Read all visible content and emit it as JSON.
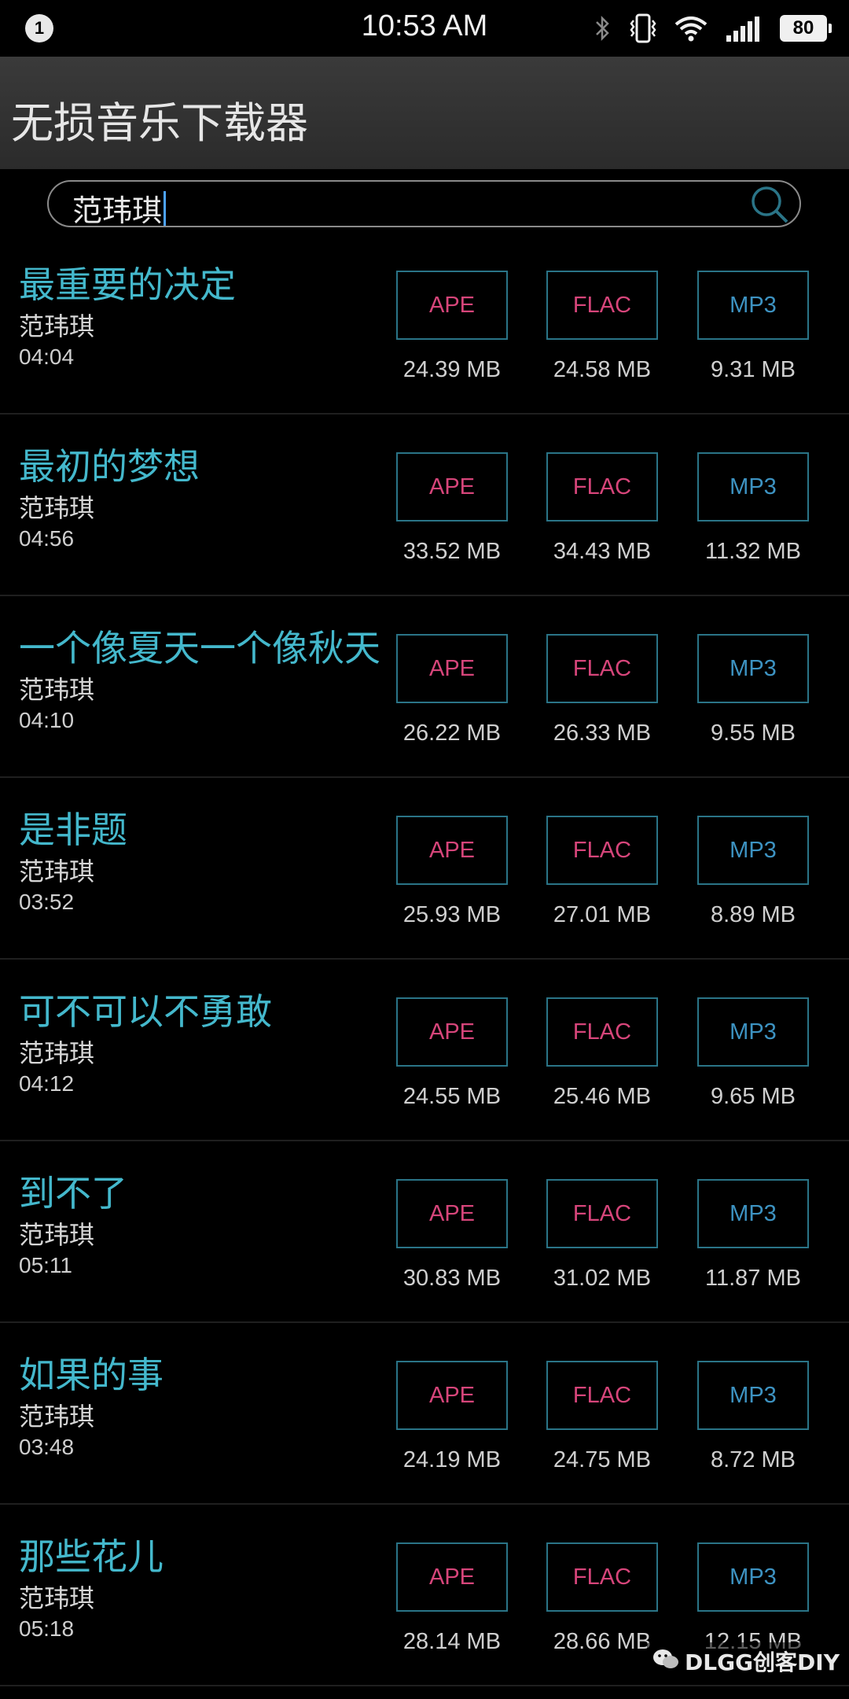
{
  "status_bar": {
    "notification_count": "1",
    "time": "10:53 AM",
    "battery": "80",
    "icons": [
      "bluetooth-icon",
      "vibrate-icon",
      "wifi-icon",
      "signal-icon",
      "battery-icon"
    ]
  },
  "app": {
    "title": "无损音乐下载器"
  },
  "search": {
    "value": "范玮琪"
  },
  "songs": [
    {
      "title": "最重要的决定",
      "artist": "范玮琪",
      "duration": "04:04",
      "ape_label": "APE",
      "flac_label": "FLAC",
      "mp3_label": "MP3",
      "ape_size": "24.39 MB",
      "flac_size": "24.58 MB",
      "mp3_size": "9.31 MB"
    },
    {
      "title": "最初的梦想",
      "artist": "范玮琪",
      "duration": "04:56",
      "ape_label": "APE",
      "flac_label": "FLAC",
      "mp3_label": "MP3",
      "ape_size": "33.52 MB",
      "flac_size": "34.43 MB",
      "mp3_size": "11.32 MB"
    },
    {
      "title": "一个像夏天一个像秋天",
      "artist": "范玮琪",
      "duration": "04:10",
      "ape_label": "APE",
      "flac_label": "FLAC",
      "mp3_label": "MP3",
      "ape_size": "26.22 MB",
      "flac_size": "26.33 MB",
      "mp3_size": "9.55 MB"
    },
    {
      "title": "是非题",
      "artist": "范玮琪",
      "duration": "03:52",
      "ape_label": "APE",
      "flac_label": "FLAC",
      "mp3_label": "MP3",
      "ape_size": "25.93 MB",
      "flac_size": "27.01 MB",
      "mp3_size": "8.89 MB"
    },
    {
      "title": "可不可以不勇敢",
      "artist": "范玮琪",
      "duration": "04:12",
      "ape_label": "APE",
      "flac_label": "FLAC",
      "mp3_label": "MP3",
      "ape_size": "24.55 MB",
      "flac_size": "25.46 MB",
      "mp3_size": "9.65 MB"
    },
    {
      "title": "到不了",
      "artist": "范玮琪",
      "duration": "05:11",
      "ape_label": "APE",
      "flac_label": "FLAC",
      "mp3_label": "MP3",
      "ape_size": "30.83 MB",
      "flac_size": "31.02 MB",
      "mp3_size": "11.87 MB"
    },
    {
      "title": "如果的事",
      "artist": "范玮琪",
      "duration": "03:48",
      "ape_label": "APE",
      "flac_label": "FLAC",
      "mp3_label": "MP3",
      "ape_size": "24.19 MB",
      "flac_size": "24.75 MB",
      "mp3_size": "8.72 MB"
    },
    {
      "title": "那些花儿",
      "artist": "范玮琪",
      "duration": "05:18",
      "ape_label": "APE",
      "flac_label": "FLAC",
      "mp3_label": "MP3",
      "ape_size": "28.14 MB",
      "flac_size": "28.66 MB",
      "mp3_size": "12.15 MB"
    }
  ],
  "watermark": {
    "text": "DLGG创客DIY"
  },
  "colors": {
    "title_accent": "#44b8cc",
    "lossless_label": "#d6457a",
    "mp3_label": "#3d93c2",
    "button_border": "#2a7487"
  }
}
